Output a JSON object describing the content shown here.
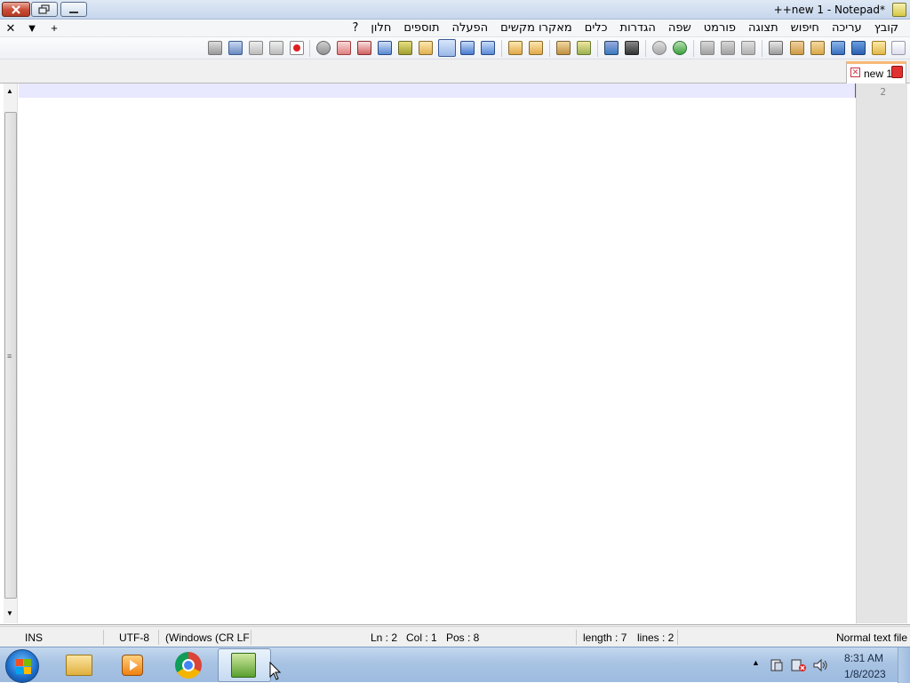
{
  "window": {
    "title": "++new 1 - Notepad*"
  },
  "menu": [
    {
      "label": "קובץ"
    },
    {
      "label": "עריכה"
    },
    {
      "label": "חיפוש"
    },
    {
      "label": "תצוגה"
    },
    {
      "label": "פורמט"
    },
    {
      "label": "שפה"
    },
    {
      "label": "הגדרות"
    },
    {
      "label": "כלים"
    },
    {
      "label": "מאקרו מקשים"
    },
    {
      "label": "הפעלה"
    },
    {
      "label": "תוספים"
    },
    {
      "label": "חלון"
    },
    {
      "label": "?"
    }
  ],
  "doc_controls": {
    "close": "✕",
    "list": "▼",
    "add": "+"
  },
  "toolbar_icons": [
    "new-file-icon",
    "open-file-icon",
    "save-icon",
    "save-all-icon",
    "close-file-icon",
    "close-all-icon",
    "print-icon",
    "cut-icon",
    "copy-icon",
    "paste-icon",
    "undo-icon",
    "redo-icon",
    "find-icon",
    "replace-icon",
    "zoom-in-icon",
    "zoom-out-icon",
    "sync-vertical-icon",
    "sync-horizontal-icon",
    "word-wrap-icon",
    "all-chars-icon",
    "indent-guide-icon",
    "udl-icon",
    "doc-map-icon",
    "function-list-icon",
    "folder-workspace-icon",
    "monitoring-icon",
    "record-macro-icon",
    "stop-record-icon",
    "playback-macro-icon",
    "run-macro-multiple-icon",
    "save-macro-icon"
  ],
  "tab": {
    "label": "new 1"
  },
  "editor": {
    "line_number": "2"
  },
  "status": {
    "file_type": "Normal text file",
    "length": "length : 7",
    "lines": "lines : 2",
    "ln": "Ln : 2",
    "col": "Col : 1",
    "pos": "Pos : 8",
    "eol": "(Windows (CR LF",
    "encoding": "UTF-8",
    "mode": "INS"
  },
  "taskbar": {
    "time": "8:31 AM",
    "date": "1/8/2023",
    "apps": [
      "windows-explorer-icon",
      "media-player-icon",
      "chrome-icon",
      "notepad-plus-plus-icon"
    ]
  },
  "colors": {
    "current_line": "#e8e8ff",
    "tab_accent": "#f8b878",
    "close_button": "#c94a35"
  }
}
